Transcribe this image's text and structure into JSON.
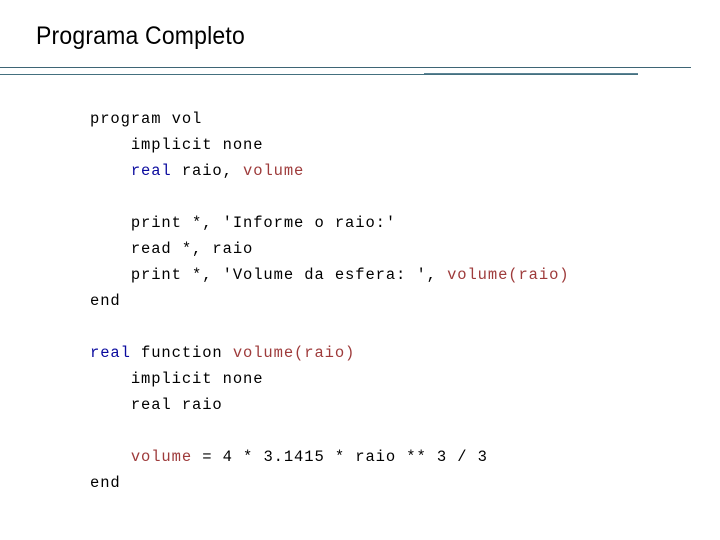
{
  "slide": {
    "title": "Programa Completo",
    "colors": {
      "rule": "#3e6575",
      "keyword": "#0a0a9e",
      "identifier": "#9e3b3b",
      "plain": "#000000",
      "background": "#ffffff"
    }
  },
  "code": {
    "language": "fortran",
    "lines": [
      {
        "indent": 0,
        "tokens": [
          {
            "t": "program vol",
            "k": "plain"
          }
        ]
      },
      {
        "indent": 1,
        "tokens": [
          {
            "t": "implicit none",
            "k": "plain"
          }
        ]
      },
      {
        "indent": 1,
        "tokens": [
          {
            "t": "real",
            "k": "kw"
          },
          {
            "t": " raio, ",
            "k": "plain"
          },
          {
            "t": "volume",
            "k": "ident"
          }
        ]
      },
      {
        "indent": 0,
        "tokens": []
      },
      {
        "indent": 1,
        "tokens": [
          {
            "t": "print *, 'Informe o raio:'",
            "k": "plain"
          }
        ]
      },
      {
        "indent": 1,
        "tokens": [
          {
            "t": "read *, raio",
            "k": "plain"
          }
        ]
      },
      {
        "indent": 1,
        "tokens": [
          {
            "t": "print *, 'Volume da esfera: ', ",
            "k": "plain"
          },
          {
            "t": "volume(raio)",
            "k": "ident"
          }
        ]
      },
      {
        "indent": 0,
        "tokens": [
          {
            "t": "end",
            "k": "plain"
          }
        ]
      },
      {
        "indent": 0,
        "tokens": []
      },
      {
        "indent": 0,
        "tokens": [
          {
            "t": "real",
            "k": "kw"
          },
          {
            "t": " function ",
            "k": "plain"
          },
          {
            "t": "volume(raio)",
            "k": "ident"
          }
        ]
      },
      {
        "indent": 1,
        "tokens": [
          {
            "t": "implicit none",
            "k": "plain"
          }
        ]
      },
      {
        "indent": 1,
        "tokens": [
          {
            "t": "real raio",
            "k": "plain"
          }
        ]
      },
      {
        "indent": 0,
        "tokens": []
      },
      {
        "indent": 1,
        "tokens": [
          {
            "t": "volume",
            "k": "ident"
          },
          {
            "t": " = 4 * 3.1415 * raio ** 3 / 3",
            "k": "plain"
          }
        ]
      },
      {
        "indent": 0,
        "tokens": [
          {
            "t": "end",
            "k": "plain"
          }
        ]
      }
    ]
  }
}
